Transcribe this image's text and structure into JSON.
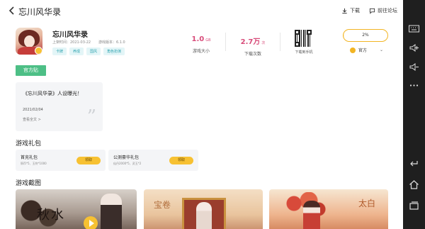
{
  "topbar": {
    "title": "忘川风华录",
    "download_label": "下载",
    "forum_label": "前往论坛"
  },
  "game": {
    "name": "忘川风华录",
    "release_date": "上架时间：2021-03-22",
    "version": "游戏版本：6.1.0",
    "tags": [
      "卡牌",
      "养成",
      "国风",
      "角色扮演"
    ]
  },
  "stats": {
    "size_value": "1.0",
    "size_unit": "GB",
    "size_label": "游戏大小",
    "downloads_value": "2.7万",
    "downloads_unit": "次",
    "downloads_label": "下载次数"
  },
  "qr": {
    "label": "下载到手机"
  },
  "download": {
    "progress_text": "2%",
    "progress": 0.02,
    "channel": "官方"
  },
  "official_badge": "官方贴",
  "news": {
    "title": "《忘川风华录》人设曝光！",
    "date": "2021/02/04",
    "more": "查看全文 >"
  },
  "gifts": {
    "section_title": "游戏礼包",
    "items": [
      {
        "name": "首充礼包",
        "desc": "铜币*5、玉符*1000",
        "button": "领取"
      },
      {
        "name": "公测豪华礼包",
        "desc": "仙丹2000*5、灵玉*2",
        "button": "领取"
      }
    ]
  },
  "screenshots": {
    "section_title": "游戏截图",
    "shot1_text": "秋水",
    "shot2_text": "宝卷",
    "shot3_text": "太白"
  },
  "colors": {
    "accent_pink": "#d84c7a",
    "accent_yellow": "#f7c132",
    "official_green": "#4dbf86",
    "tag_teal": "#2ea3b0",
    "navbar_bg": "#1f1f1f"
  }
}
